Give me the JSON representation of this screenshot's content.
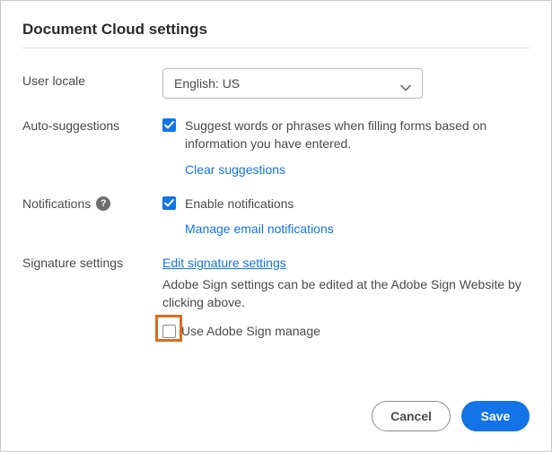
{
  "title": "Document Cloud settings",
  "locale": {
    "label": "User locale",
    "value": "English: US"
  },
  "autosuggest": {
    "label": "Auto-suggestions",
    "checkbox_text": "Suggest words or phrases when filling forms based on information you have entered.",
    "clear_link": "Clear suggestions",
    "checked": true
  },
  "notifications": {
    "label": "Notifications",
    "checkbox_text": "Enable notifications",
    "manage_link": "Manage email notifications",
    "checked": true
  },
  "signature": {
    "label": "Signature settings",
    "edit_link": "Edit signature settings",
    "description": "Adobe Sign settings can be edited at the Adobe Sign Website by clicking above.",
    "use_adobe_sign_label": "Use Adobe Sign manage",
    "use_adobe_sign_checked": false
  },
  "buttons": {
    "cancel": "Cancel",
    "save": "Save"
  }
}
